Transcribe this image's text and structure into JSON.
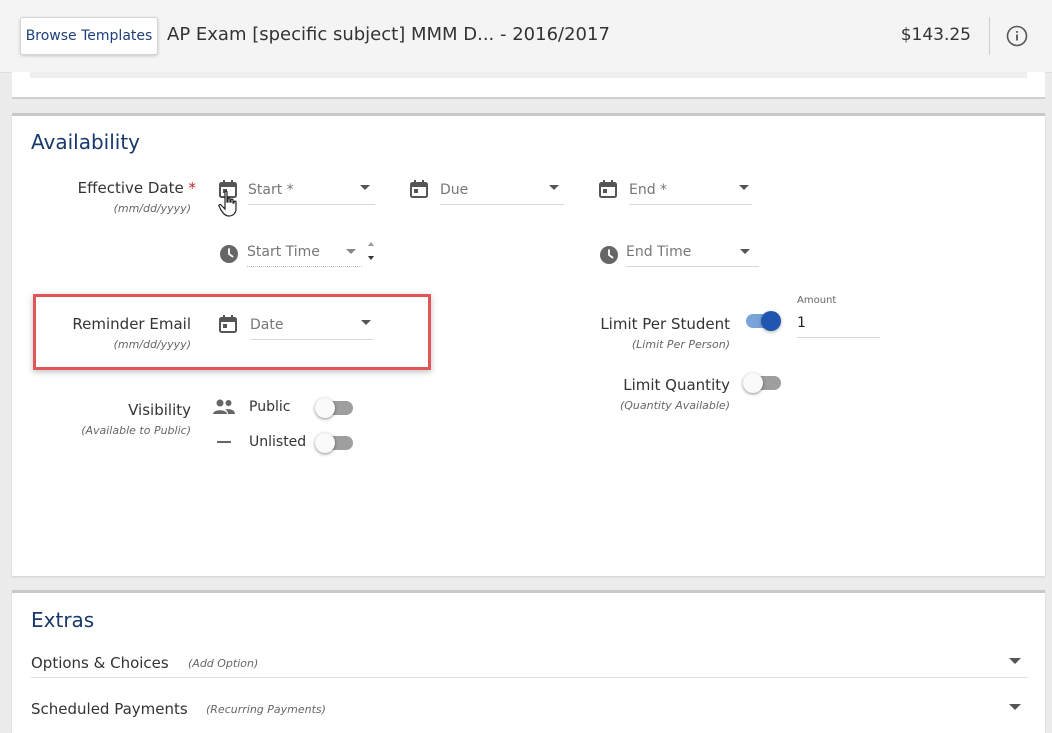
{
  "header": {
    "browse_label": "Browse Templates",
    "title": "AP Exam [specific subject] MMM D...  - 2016/2017",
    "price": "$143.25",
    "info_icon": "info-circle-icon"
  },
  "availability": {
    "section_title": "Availability",
    "effective_date": {
      "label": "Effective Date",
      "required_mark": "*",
      "sub": "(mm/dd/yyyy)",
      "start_placeholder": "Start *",
      "due_placeholder": "Due",
      "end_placeholder": "End *",
      "start_time_placeholder": "Start Time",
      "end_time_placeholder": "End Time"
    },
    "reminder_email": {
      "label": "Reminder Email",
      "sub": "(mm/dd/yyyy)",
      "date_placeholder": "Date"
    },
    "visibility": {
      "label": "Visibility",
      "sub": "(Available to Public)",
      "public_label": "Public",
      "unlisted_label": "Unlisted",
      "public_on": false,
      "unlisted_on": false
    },
    "limit_per_student": {
      "label": "Limit Per Student",
      "sub": "(Limit Per Person)",
      "amount_label": "Amount",
      "amount_value": "1",
      "enabled": true
    },
    "limit_quantity": {
      "label": "Limit Quantity",
      "sub": "(Quantity Available)",
      "enabled": false
    }
  },
  "extras": {
    "section_title": "Extras",
    "rows": [
      {
        "label": "Options & Choices",
        "sub": "(Add Option)"
      },
      {
        "label": "Scheduled Payments",
        "sub": "(Recurring Payments)"
      }
    ]
  },
  "colors": {
    "brand": "#17386b",
    "highlight": "#e05656",
    "toggle_on": "#1f57b0"
  }
}
